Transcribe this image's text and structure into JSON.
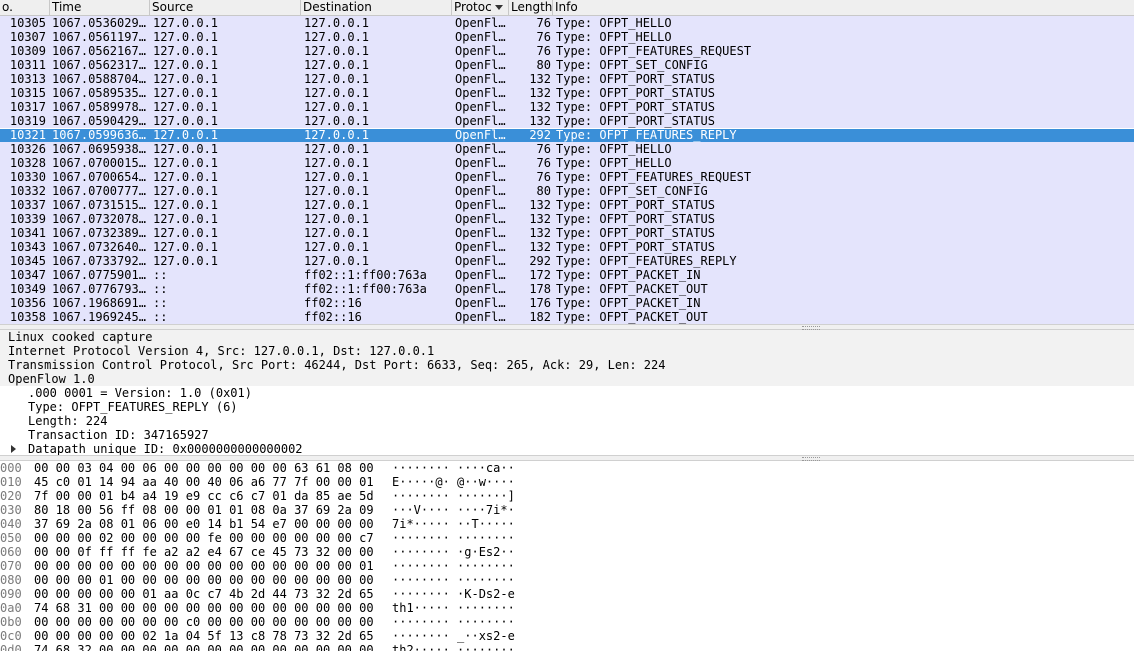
{
  "packet_list": {
    "columns": [
      {
        "label": "o."
      },
      {
        "label": "Time"
      },
      {
        "label": "Source"
      },
      {
        "label": "Destination"
      },
      {
        "label": "Protoc"
      },
      {
        "label": "Length"
      },
      {
        "label": "Info"
      }
    ],
    "sort_icon": "sort-descending-icon",
    "selected_row_color": "#3a8fd8",
    "row_color": "#e4e4fc",
    "rows": [
      {
        "no": "10305",
        "time": "1067.0536029…",
        "src": "127.0.0.1",
        "dst": "127.0.0.1",
        "proto": "OpenFl…",
        "len": "76",
        "info": "Type: OFPT_HELLO"
      },
      {
        "no": "10307",
        "time": "1067.0561197…",
        "src": "127.0.0.1",
        "dst": "127.0.0.1",
        "proto": "OpenFl…",
        "len": "76",
        "info": "Type: OFPT_HELLO"
      },
      {
        "no": "10309",
        "time": "1067.0562167…",
        "src": "127.0.0.1",
        "dst": "127.0.0.1",
        "proto": "OpenFl…",
        "len": "76",
        "info": "Type: OFPT_FEATURES_REQUEST"
      },
      {
        "no": "10311",
        "time": "1067.0562317…",
        "src": "127.0.0.1",
        "dst": "127.0.0.1",
        "proto": "OpenFl…",
        "len": "80",
        "info": "Type: OFPT_SET_CONFIG"
      },
      {
        "no": "10313",
        "time": "1067.0588704…",
        "src": "127.0.0.1",
        "dst": "127.0.0.1",
        "proto": "OpenFl…",
        "len": "132",
        "info": "Type: OFPT_PORT_STATUS"
      },
      {
        "no": "10315",
        "time": "1067.0589535…",
        "src": "127.0.0.1",
        "dst": "127.0.0.1",
        "proto": "OpenFl…",
        "len": "132",
        "info": "Type: OFPT_PORT_STATUS"
      },
      {
        "no": "10317",
        "time": "1067.0589978…",
        "src": "127.0.0.1",
        "dst": "127.0.0.1",
        "proto": "OpenFl…",
        "len": "132",
        "info": "Type: OFPT_PORT_STATUS"
      },
      {
        "no": "10319",
        "time": "1067.0590429…",
        "src": "127.0.0.1",
        "dst": "127.0.0.1",
        "proto": "OpenFl…",
        "len": "132",
        "info": "Type: OFPT_PORT_STATUS"
      },
      {
        "no": "10321",
        "time": "1067.0599636…",
        "src": "127.0.0.1",
        "dst": "127.0.0.1",
        "proto": "OpenFl…",
        "len": "292",
        "info": "Type: OFPT_FEATURES_REPLY",
        "selected": true
      },
      {
        "no": "10326",
        "time": "1067.0695938…",
        "src": "127.0.0.1",
        "dst": "127.0.0.1",
        "proto": "OpenFl…",
        "len": "76",
        "info": "Type: OFPT_HELLO"
      },
      {
        "no": "10328",
        "time": "1067.0700015…",
        "src": "127.0.0.1",
        "dst": "127.0.0.1",
        "proto": "OpenFl…",
        "len": "76",
        "info": "Type: OFPT_HELLO"
      },
      {
        "no": "10330",
        "time": "1067.0700654…",
        "src": "127.0.0.1",
        "dst": "127.0.0.1",
        "proto": "OpenFl…",
        "len": "76",
        "info": "Type: OFPT_FEATURES_REQUEST"
      },
      {
        "no": "10332",
        "time": "1067.0700777…",
        "src": "127.0.0.1",
        "dst": "127.0.0.1",
        "proto": "OpenFl…",
        "len": "80",
        "info": "Type: OFPT_SET_CONFIG"
      },
      {
        "no": "10337",
        "time": "1067.0731515…",
        "src": "127.0.0.1",
        "dst": "127.0.0.1",
        "proto": "OpenFl…",
        "len": "132",
        "info": "Type: OFPT_PORT_STATUS"
      },
      {
        "no": "10339",
        "time": "1067.0732078…",
        "src": "127.0.0.1",
        "dst": "127.0.0.1",
        "proto": "OpenFl…",
        "len": "132",
        "info": "Type: OFPT_PORT_STATUS"
      },
      {
        "no": "10341",
        "time": "1067.0732389…",
        "src": "127.0.0.1",
        "dst": "127.0.0.1",
        "proto": "OpenFl…",
        "len": "132",
        "info": "Type: OFPT_PORT_STATUS"
      },
      {
        "no": "10343",
        "time": "1067.0732640…",
        "src": "127.0.0.1",
        "dst": "127.0.0.1",
        "proto": "OpenFl…",
        "len": "132",
        "info": "Type: OFPT_PORT_STATUS"
      },
      {
        "no": "10345",
        "time": "1067.0733792…",
        "src": "127.0.0.1",
        "dst": "127.0.0.1",
        "proto": "OpenFl…",
        "len": "292",
        "info": "Type: OFPT_FEATURES_REPLY"
      },
      {
        "no": "10347",
        "time": "1067.0775901…",
        "src": "::",
        "dst": "ff02::1:ff00:763a",
        "proto": "OpenFl…",
        "len": "172",
        "info": "Type: OFPT_PACKET_IN"
      },
      {
        "no": "10349",
        "time": "1067.0776793…",
        "src": "::",
        "dst": "ff02::1:ff00:763a",
        "proto": "OpenFl…",
        "len": "178",
        "info": "Type: OFPT_PACKET_OUT"
      },
      {
        "no": "10356",
        "time": "1067.1968691…",
        "src": "::",
        "dst": "ff02::16",
        "proto": "OpenFl…",
        "len": "176",
        "info": "Type: OFPT_PACKET_IN"
      },
      {
        "no": "10358",
        "time": "1067.1969245…",
        "src": "::",
        "dst": "ff02::16",
        "proto": "OpenFl…",
        "len": "182",
        "info": "Type: OFPT_PACKET_OUT"
      }
    ]
  },
  "details": {
    "layers": [
      "Linux cooked capture",
      "Internet Protocol Version 4, Src: 127.0.0.1, Dst: 127.0.0.1",
      "Transmission Control Protocol, Src Port: 46244, Dst Port: 6633, Seq: 265, Ack: 29, Len: 224",
      "OpenFlow 1.0"
    ],
    "openflow_fields": [
      ".000 0001 = Version: 1.0 (0x01)",
      "Type: OFPT_FEATURES_REPLY (6)",
      "Length: 224",
      "Transaction ID: 347165927"
    ],
    "datapath_field": "Datapath unique ID: 0x0000000000000002",
    "expander_icon": "triangle-right-icon"
  },
  "hex_dump": {
    "rows": [
      {
        "offset": "000",
        "hex": "00 00 03 04 00 06 00 00  00 00 00 00 63 61 08 00",
        "ascii": "········ ····ca··"
      },
      {
        "offset": "010",
        "hex": "45 c0 01 14 94 aa 40 00  40 06 a6 77 7f 00 00 01",
        "ascii": "E·····@· @··w····"
      },
      {
        "offset": "020",
        "hex": "7f 00 00 01 b4 a4 19 e9  cc c6 c7 01 da 85 ae 5d",
        "ascii": "········ ·······]"
      },
      {
        "offset": "030",
        "hex": "80 18 00 56 ff 08 00 00  01 01 08 0a 37 69 2a 09",
        "ascii": "···V···· ····7i*·"
      },
      {
        "offset": "040",
        "hex": "37 69 2a 08 01 06 00 e0  14 b1 54 e7 00 00 00 00",
        "ascii": "7i*····· ··T·····"
      },
      {
        "offset": "050",
        "hex": "00 00 00 02 00 00 00 00  fe 00 00 00 00 00 00 c7",
        "ascii": "········ ········"
      },
      {
        "offset": "060",
        "hex": "00 00 0f ff ff fe a2 a2  e4 67 ce 45 73 32 00 00",
        "ascii": "········ ·g·Es2··"
      },
      {
        "offset": "070",
        "hex": "00 00 00 00 00 00 00 00  00 00 00 00 00 00 00 01",
        "ascii": "········ ········"
      },
      {
        "offset": "080",
        "hex": "00 00 00 01 00 00 00 00  00 00 00 00 00 00 00 00",
        "ascii": "········ ········"
      },
      {
        "offset": "090",
        "hex": "00 00 00 00 00 01 aa 0c  c7 4b 2d 44 73 32 2d 65",
        "ascii": "········ ·K-Ds2-e"
      },
      {
        "offset": "0a0",
        "hex": "74 68 31 00 00 00 00 00  00 00 00 00 00 00 00 00",
        "ascii": "th1····· ········"
      },
      {
        "offset": "0b0",
        "hex": "00 00 00 00 00 00 00 c0  00 00 00 00 00 00 00 00",
        "ascii": "········ ········"
      },
      {
        "offset": "0c0",
        "hex": "00 00 00 00 00 02 1a 04  5f 13 c8 78 73 32 2d 65",
        "ascii": "········ _··xs2-e"
      },
      {
        "offset": "0d0",
        "hex": "74 68 32 00 00 00 00 00  00 00 00 00 00 00 00 00",
        "ascii": "th2····· ········"
      }
    ]
  }
}
